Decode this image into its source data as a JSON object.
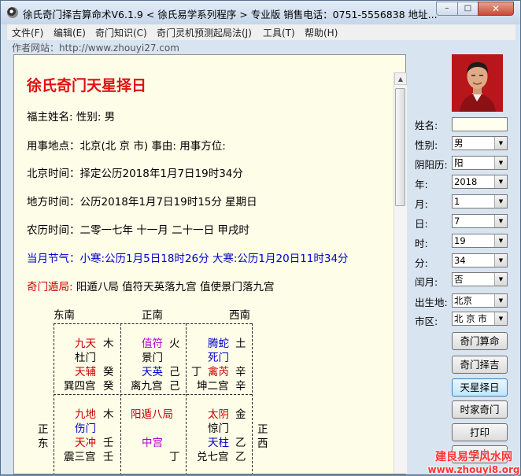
{
  "window": {
    "title": "徐氏奇门择吉算命术V6.1.9 < 徐氏易学系列程序 > 专业版    销售电话：0751-5556838    地址...",
    "min_label": "–",
    "max_label": "□",
    "close_label": "✕"
  },
  "menu": [
    "文件(F)",
    "编辑(E)",
    "奇门知识(C)",
    "奇门灵机预测起局法(J)",
    "工具(T)",
    "帮助(H)"
  ],
  "website": "作者网站：http://www.zhouyi27.com",
  "report": {
    "heading": "徐氏奇门天星择日",
    "lines": [
      "福主姓名:   性别: 男",
      "用事地点：北京(北 京 市)   事由:     用事方位:",
      "北京时间：择定公历2018年1月7日19时34分",
      "地方时间：公历2018年1月7日19时15分  星期日",
      "农历时间：二零一七年  十一月  二十一日  甲戌时"
    ],
    "jieqi_label": "当月节气：",
    "jieqi_value": "小寒:公历1月5日18时26分 大寒:公历1月20日11时34分",
    "dunju_label": "奇门遁局:",
    "dunju_value": "阳遁八局  值符天英落九宫  值使景门落九宫"
  },
  "chart": {
    "directions": {
      "se": "东南",
      "s": "正南",
      "sw": "西南",
      "e1": "正",
      "e2": "东",
      "w1": "正",
      "w2": "西"
    },
    "palaces": {
      "xun": {
        "r1a": "九天",
        "r1b": "木",
        "r2": "杜门",
        "r3a": "天辅",
        "r3b": "癸",
        "r4a": "巽四宫",
        "r4b": "癸"
      },
      "li": {
        "r1a": "值符",
        "r1b": "火",
        "r2": "景门",
        "r3a": "天英",
        "r3b": "己",
        "r4a": "离九宫",
        "r4b": "己"
      },
      "kun": {
        "r1a": "腾蛇",
        "r1b": "土",
        "r2": "死门",
        "r3l": "丁",
        "r3a": "禽芮",
        "r3b": "辛",
        "r4a": "坤二宫",
        "r4b": "辛"
      },
      "zhen": {
        "r1a": "九地",
        "r1b": "木",
        "r2": "伤门",
        "r3a": "天冲",
        "r3b": "壬",
        "r4a": "震三宫",
        "r4b": "壬"
      },
      "zhong": {
        "r1": "阳遁八局",
        "r3": "中宫",
        "r4b": "丁"
      },
      "dui": {
        "r1a": "太阴",
        "r1b": "金",
        "r2": "惊门",
        "r3a": "天柱",
        "r3b": "乙",
        "r4a": "兑七宫",
        "r4b": "乙"
      }
    }
  },
  "form": {
    "name_label": "姓名:",
    "name_value": "",
    "sex_label": "性别:",
    "sex_value": "男",
    "calendar_label": "阴阳历:",
    "calendar_value": "阳",
    "year_label": "年:",
    "year_value": "2018",
    "month_label": "月:",
    "month_value": "1",
    "day_label": "日:",
    "day_value": "7",
    "hour_label": "时:",
    "hour_value": "19",
    "minute_label": "分:",
    "minute_value": "34",
    "leap_label": "闰月:",
    "leap_value": "否",
    "birthplace_label": "出生地:",
    "birthplace_value": "北京",
    "district_label": "市区:",
    "district_value": "北 京 市"
  },
  "buttons": [
    "奇门算命",
    "奇门择吉",
    "天星择日",
    "时家奇门",
    "打印",
    "退出"
  ],
  "watermark": {
    "line1": "建良易学风水网",
    "line2": "www.zhouyi8.org"
  }
}
